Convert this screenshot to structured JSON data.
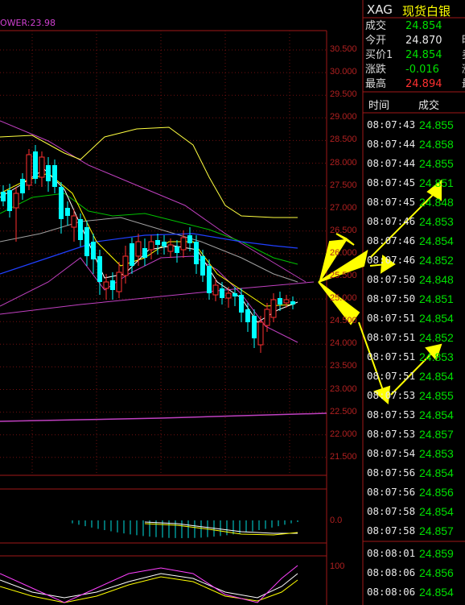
{
  "indicator_label": "OWER:23.98",
  "price_axis": [
    "30.500",
    "30.000",
    "29.500",
    "29.000",
    "28.500",
    "28.000",
    "27.500",
    "27.000",
    "26.500",
    "26.000",
    "25.500",
    "25.000",
    "24.500",
    "24.000",
    "23.500",
    "23.000",
    "22.500",
    "22.000",
    "21.500"
  ],
  "macd_axis": "0.0",
  "kdj_axis": "100",
  "quote": {
    "symbol": "XAG",
    "name": "现货白银",
    "rows": [
      {
        "label": "成交",
        "value": "24.854",
        "color": "green",
        "extra": ""
      },
      {
        "label": "今开",
        "value": "24.870",
        "color": "white",
        "extra": "昨"
      },
      {
        "label": "买价1",
        "value": "24.854",
        "color": "green",
        "extra": "卖"
      },
      {
        "label": "涨跌",
        "value": "-0.016",
        "color": "green",
        "extra": "涨"
      },
      {
        "label": "最高",
        "value": "24.894",
        "color": "red",
        "extra": "最"
      }
    ]
  },
  "ticks": {
    "col_time": "时间",
    "col_price": "成交",
    "rows": [
      {
        "time": "08:07:43",
        "price": "24.855",
        "color": "green"
      },
      {
        "time": "08:07:44",
        "price": "24.858",
        "color": "green"
      },
      {
        "time": "08:07:44",
        "price": "24.855",
        "color": "green"
      },
      {
        "time": "08:07:45",
        "price": "24.851",
        "color": "green"
      },
      {
        "time": "08:07:45",
        "price": "24.848",
        "color": "green"
      },
      {
        "time": "08:07:46",
        "price": "24.853",
        "color": "green"
      },
      {
        "time": "08:07:46",
        "price": "24.854",
        "color": "green"
      },
      {
        "time": "08:07:46",
        "price": "24.852",
        "color": "green"
      },
      {
        "time": "08:07:50",
        "price": "24.848",
        "color": "green"
      },
      {
        "time": "08:07:50",
        "price": "24.851",
        "color": "green"
      },
      {
        "time": "08:07:51",
        "price": "24.854",
        "color": "green"
      },
      {
        "time": "08:07:51",
        "price": "24.852",
        "color": "green"
      },
      {
        "time": "08:07:51",
        "price": "24.853",
        "color": "green"
      },
      {
        "time": "08:07:51",
        "price": "24.854",
        "color": "green"
      },
      {
        "time": "08:07:53",
        "price": "24.855",
        "color": "green"
      },
      {
        "time": "08:07:53",
        "price": "24.854",
        "color": "green"
      },
      {
        "time": "08:07:53",
        "price": "24.857",
        "color": "green"
      },
      {
        "time": "08:07:54",
        "price": "24.853",
        "color": "green"
      },
      {
        "time": "08:07:56",
        "price": "24.854",
        "color": "green"
      },
      {
        "time": "08:07:56",
        "price": "24.856",
        "color": "green"
      },
      {
        "time": "08:07:58",
        "price": "24.854",
        "color": "green"
      },
      {
        "time": "08:07:58",
        "price": "24.857",
        "color": "green"
      },
      {
        "time": "08:08:01",
        "price": "24.859",
        "color": "green"
      },
      {
        "time": "08:08:06",
        "price": "24.856",
        "color": "green"
      },
      {
        "time": "08:08:06",
        "price": "24.854",
        "color": "green"
      }
    ]
  },
  "colors": {
    "up": "#ff3030",
    "down": "#00ffff",
    "grid": "#a01818",
    "ma5": "#ffffff",
    "ma10": "#ffff00",
    "ma20": "#00c000",
    "ma60": "#2040ff",
    "boll": "#ffff40",
    "envelope": "#c040c0",
    "arrow": "#ffff00"
  }
}
